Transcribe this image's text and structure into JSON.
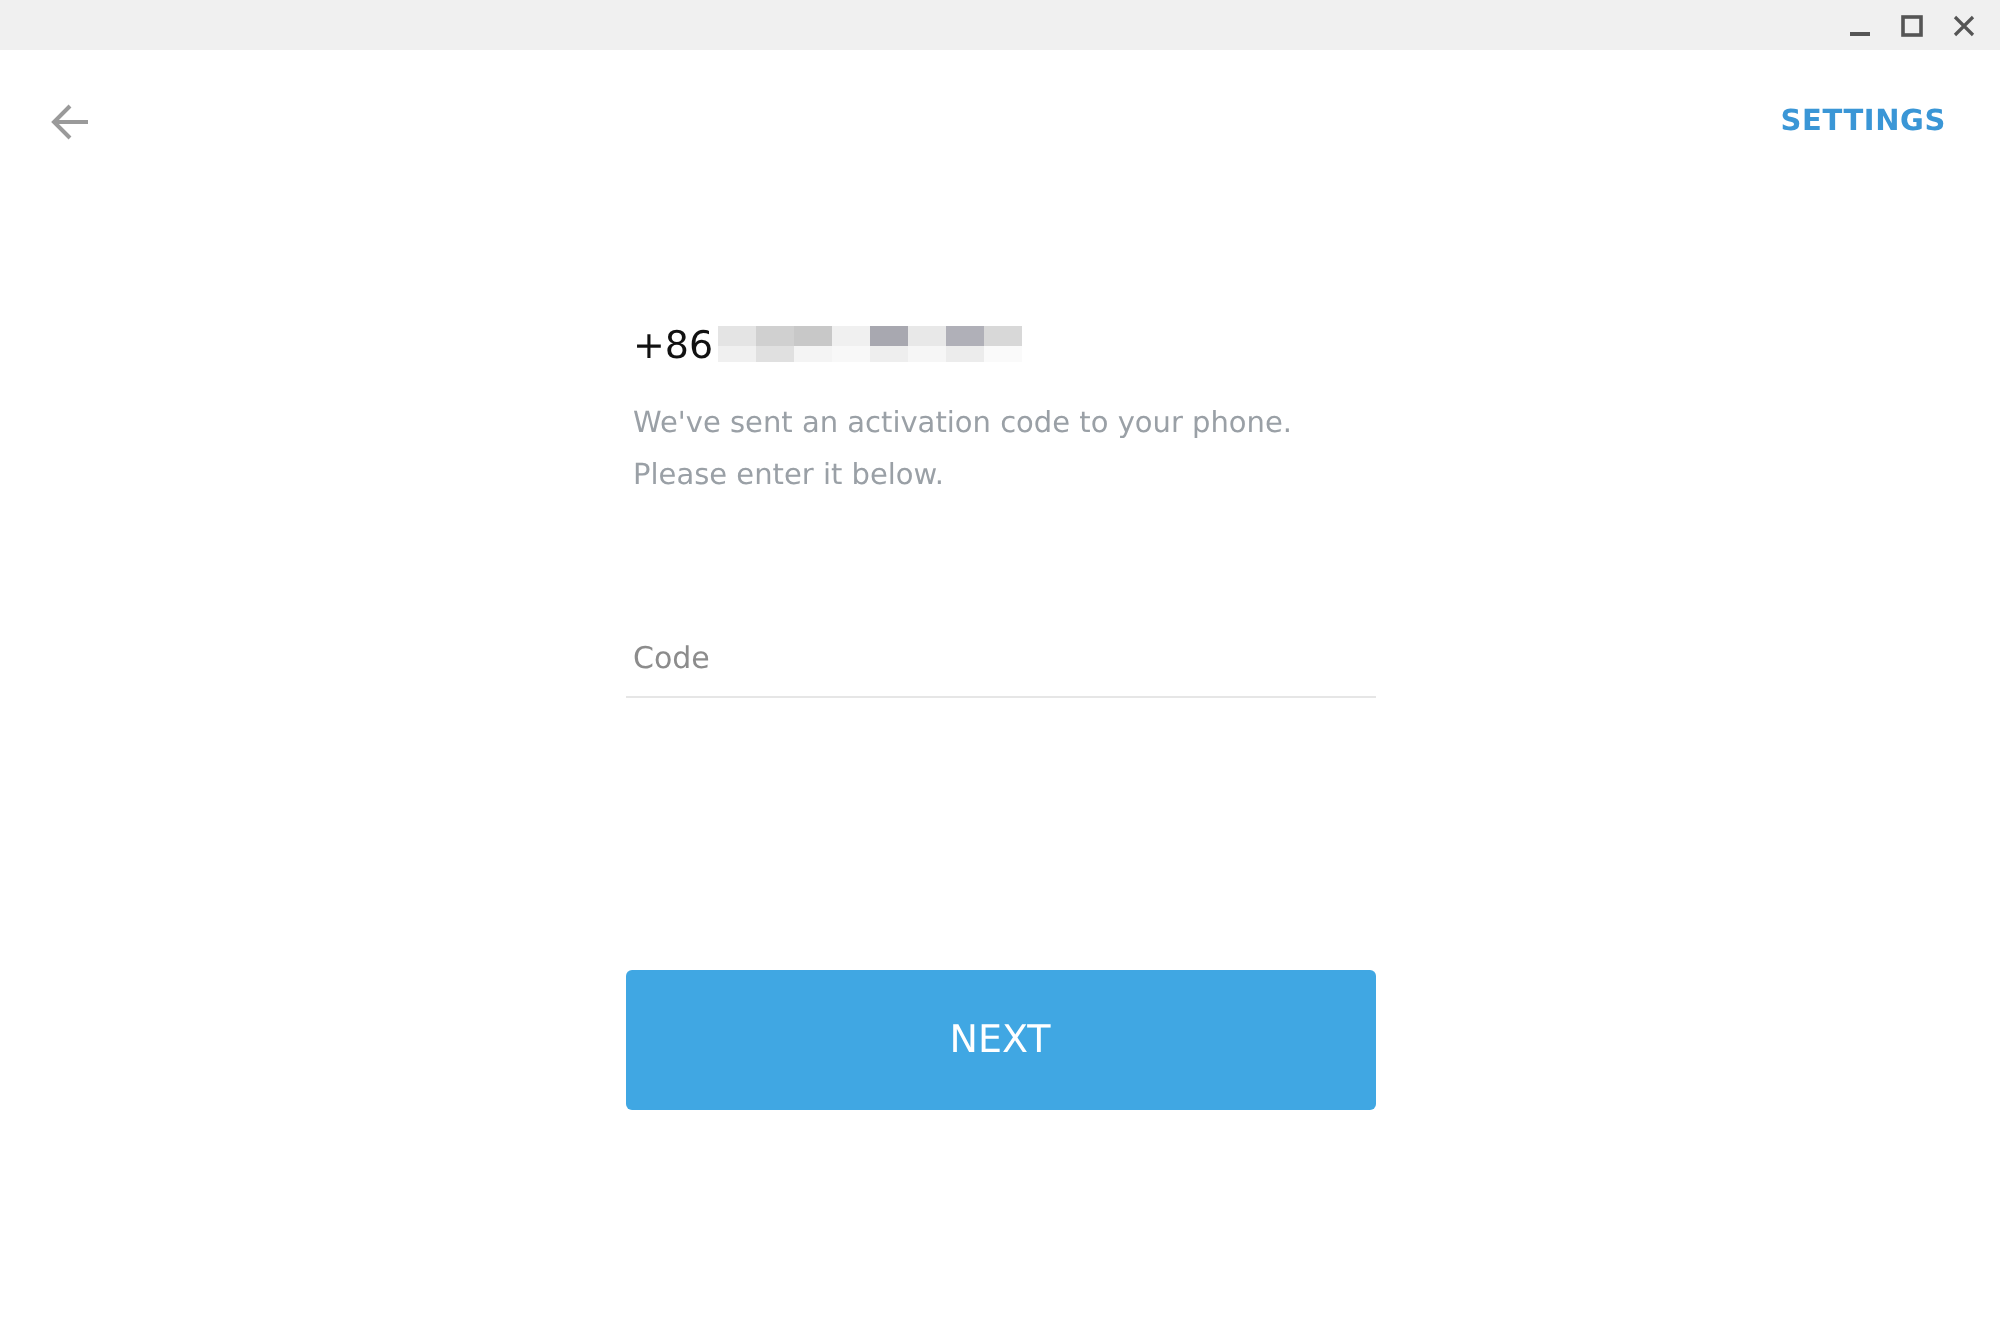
{
  "top_bar": {
    "settings_link": "SETTINGS"
  },
  "phone": {
    "country_code": "+86"
  },
  "message": [
    "We've sent an activation code to your phone.",
    "Please enter it below."
  ],
  "code_field": {
    "placeholder": "Code"
  },
  "next_button": "NEXT"
}
